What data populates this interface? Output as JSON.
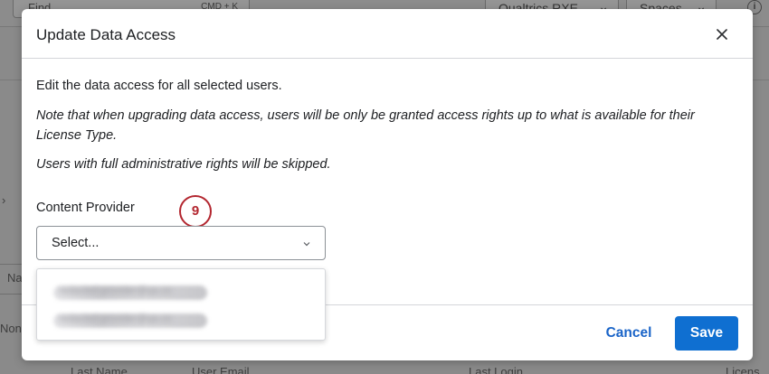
{
  "background": {
    "find_placeholder": "Find",
    "find_shortcut": "CMD + K",
    "brand_dropdown": "Qualtrics RXE",
    "spaces_dropdown": "Spaces",
    "info_icon": "i",
    "fragments": {
      "side_chevron": "›",
      "na_label": "Na",
      "non_label": "Non",
      "last_name": "Last Name",
      "user_email": "User Email",
      "last_login": "Last Login",
      "license": "Licens"
    }
  },
  "modal": {
    "title": "Update Data Access",
    "intro": "Edit the data access for all selected users.",
    "note": "Note that when upgrading data access, users will be only be granted access rights up to what is available for their License Type.",
    "skip_note": "Users with full administrative rights will be skipped.",
    "field_label": "Content Provider",
    "step_badge": "9",
    "select_value": "Select...",
    "options": [
      "redacted-provider@qa.co",
      "redacted-provider@qa.co"
    ],
    "cancel_label": "Cancel",
    "save_label": "Save"
  },
  "colors": {
    "accent": "#0f6fd1",
    "link": "#1a64c8",
    "badge": "#b3262f"
  }
}
